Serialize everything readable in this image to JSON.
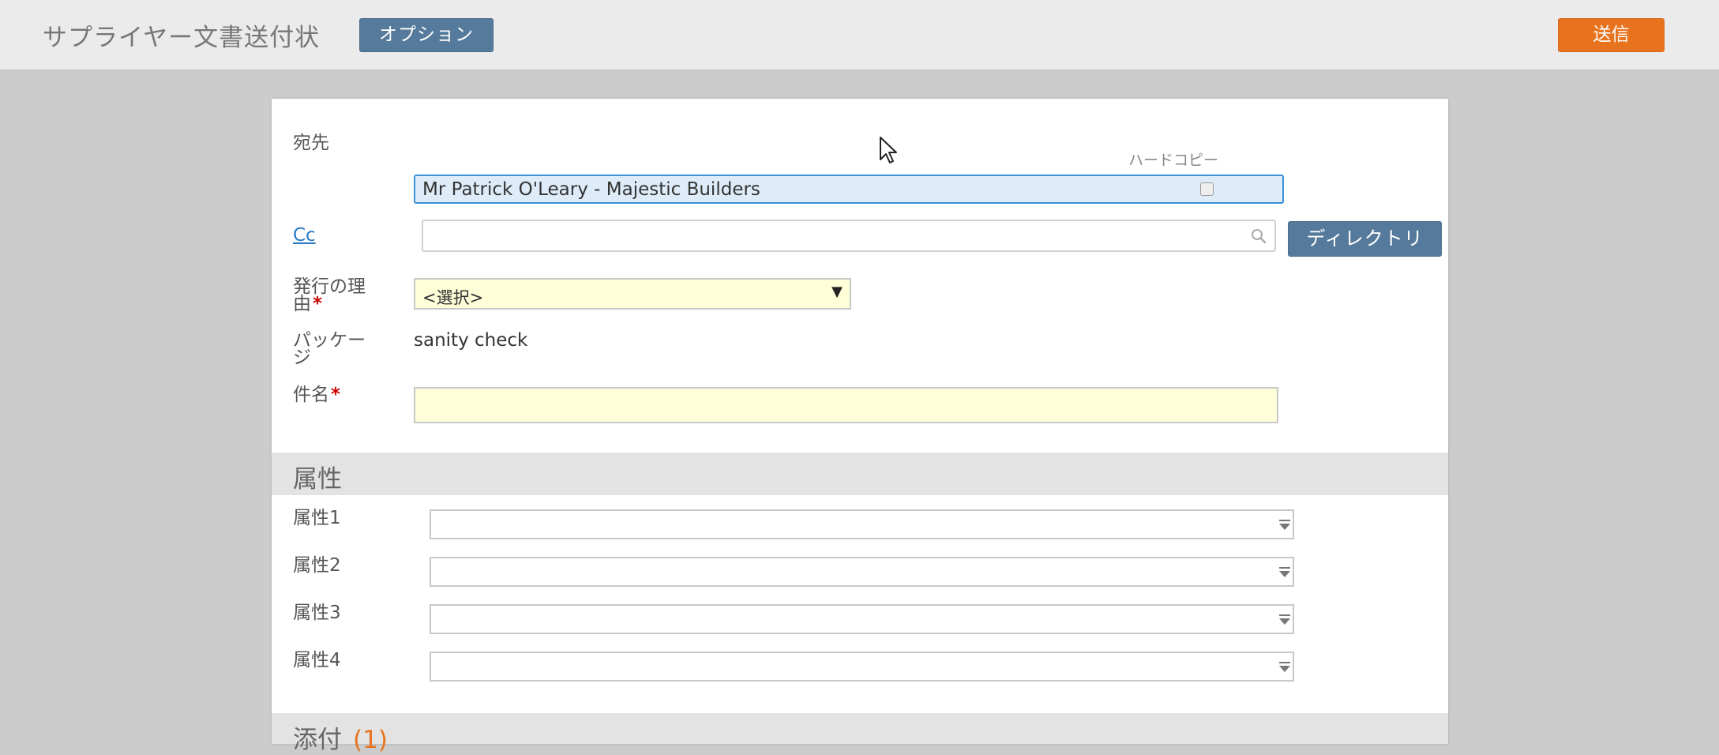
{
  "header": {
    "title": "サプライヤー文書送付状",
    "options_label": "オプション",
    "send_label": "送信"
  },
  "form": {
    "to_label": "宛先",
    "to_value": "Mr Patrick O'Leary - Majestic Builders",
    "hardcopy_label": "ハードコピー",
    "cc_label": "Cc",
    "cc_value": "",
    "directory_label": "ディレクトリ",
    "reason_label_line1": "発行の理",
    "reason_label_line2": "由",
    "reason_value": "<選択>",
    "package_label_line1": "パッケー",
    "package_label_line2": "ジ",
    "package_value": "sanity check",
    "subject_label": "件名",
    "subject_value": "",
    "required_mark": "*"
  },
  "attributes": {
    "section_title": "属性",
    "items": [
      {
        "label": "属性1",
        "value": ""
      },
      {
        "label": "属性2",
        "value": ""
      },
      {
        "label": "属性3",
        "value": ""
      },
      {
        "label": "属性4",
        "value": ""
      }
    ]
  },
  "attachments": {
    "section_title": "添付",
    "count": "(1)"
  },
  "colors": {
    "accent_blue": "#557a9b",
    "send_orange": "#e8731e",
    "required_red": "#cc0000",
    "field_yellow": "#fefed8",
    "to_field_blue": "#ddecf8",
    "link_blue": "#2a7ac4"
  },
  "icons": {
    "search": "search-icon",
    "dropdown": "chevron-down-icon",
    "cursor": "mouse-cursor-icon"
  }
}
